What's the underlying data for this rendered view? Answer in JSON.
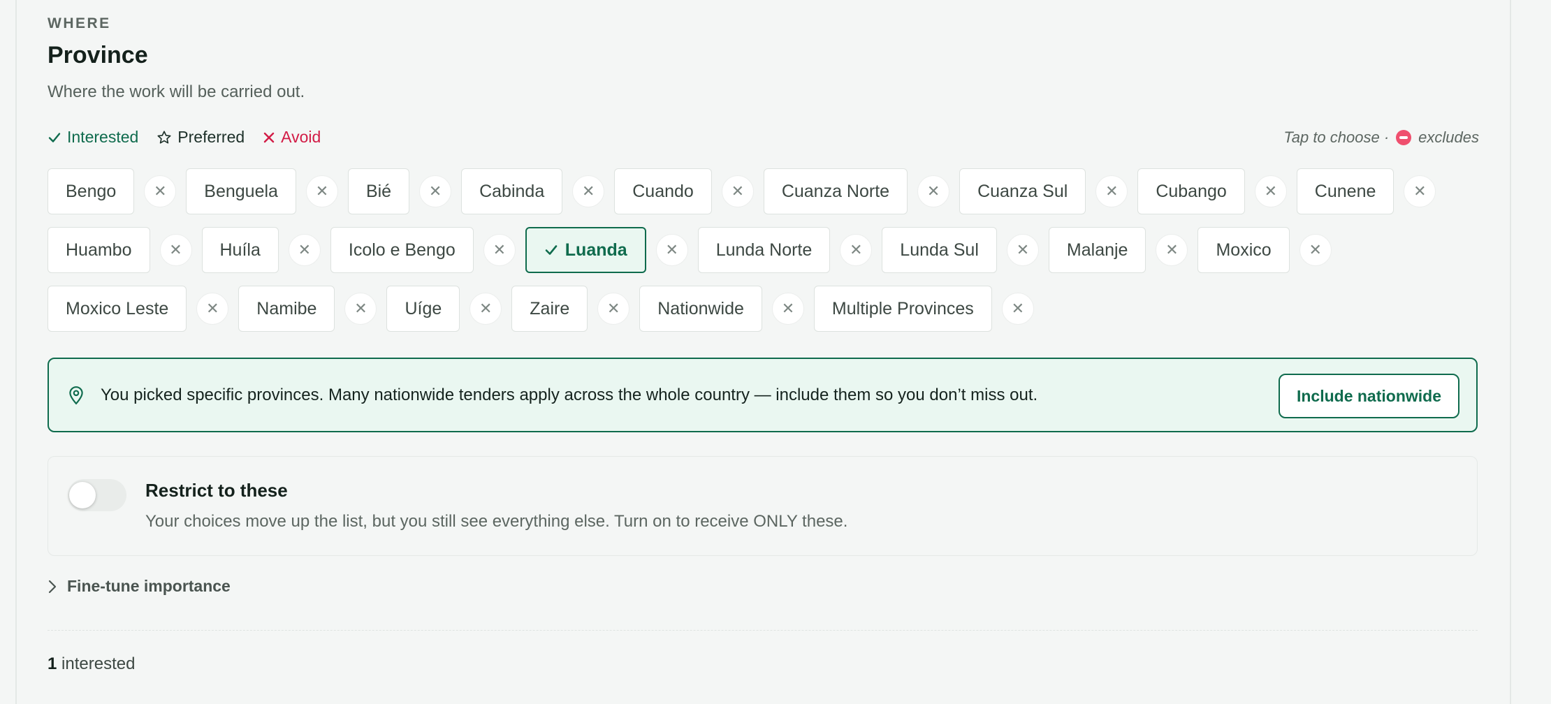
{
  "section": {
    "eyebrow": "WHERE",
    "title": "Province",
    "subtitle": "Where the work will be carried out."
  },
  "legend": {
    "interested": "Interested",
    "preferred": "Preferred",
    "avoid": "Avoid",
    "hint_prefix": "Tap to choose ·",
    "hint_suffix": "excludes"
  },
  "provinces": [
    {
      "label": "Bengo",
      "selected": false
    },
    {
      "label": "Benguela",
      "selected": false
    },
    {
      "label": "Bié",
      "selected": false
    },
    {
      "label": "Cabinda",
      "selected": false
    },
    {
      "label": "Cuando",
      "selected": false
    },
    {
      "label": "Cuanza Norte",
      "selected": false
    },
    {
      "label": "Cuanza Sul",
      "selected": false
    },
    {
      "label": "Cubango",
      "selected": false
    },
    {
      "label": "Cunene",
      "selected": false
    },
    {
      "label": "Huambo",
      "selected": false
    },
    {
      "label": "Huíla",
      "selected": false
    },
    {
      "label": "Icolo e Bengo",
      "selected": false
    },
    {
      "label": "Luanda",
      "selected": true
    },
    {
      "label": "Lunda Norte",
      "selected": false
    },
    {
      "label": "Lunda Sul",
      "selected": false
    },
    {
      "label": "Malanje",
      "selected": false
    },
    {
      "label": "Moxico",
      "selected": false
    },
    {
      "label": "Moxico Leste",
      "selected": false
    },
    {
      "label": "Namibe",
      "selected": false
    },
    {
      "label": "Uíge",
      "selected": false
    },
    {
      "label": "Zaire",
      "selected": false
    },
    {
      "label": "Nationwide",
      "selected": false
    },
    {
      "label": "Multiple Provinces",
      "selected": false
    }
  ],
  "banner": {
    "text": "You picked specific provinces. Many nationwide tenders apply across the whole country — include them so you don’t miss out.",
    "button": "Include nationwide"
  },
  "restrict": {
    "title": "Restrict to these",
    "description": "Your choices move up the list, but you still see everything else. Turn on to receive ONLY these.",
    "enabled": false
  },
  "finetune": {
    "label": "Fine-tune importance"
  },
  "summary": {
    "count": "1",
    "label": "interested"
  },
  "colors": {
    "accent": "#0f6b4d",
    "avoid": "#d21c46",
    "exclude": "#ef4f6e"
  },
  "icons": {
    "interested": "check-icon",
    "preferred": "star-outline-icon",
    "avoid": "x-icon",
    "exclude": "no-entry-icon",
    "remove": "close-icon",
    "banner": "map-pin-icon",
    "expand": "chevron-right-icon"
  }
}
